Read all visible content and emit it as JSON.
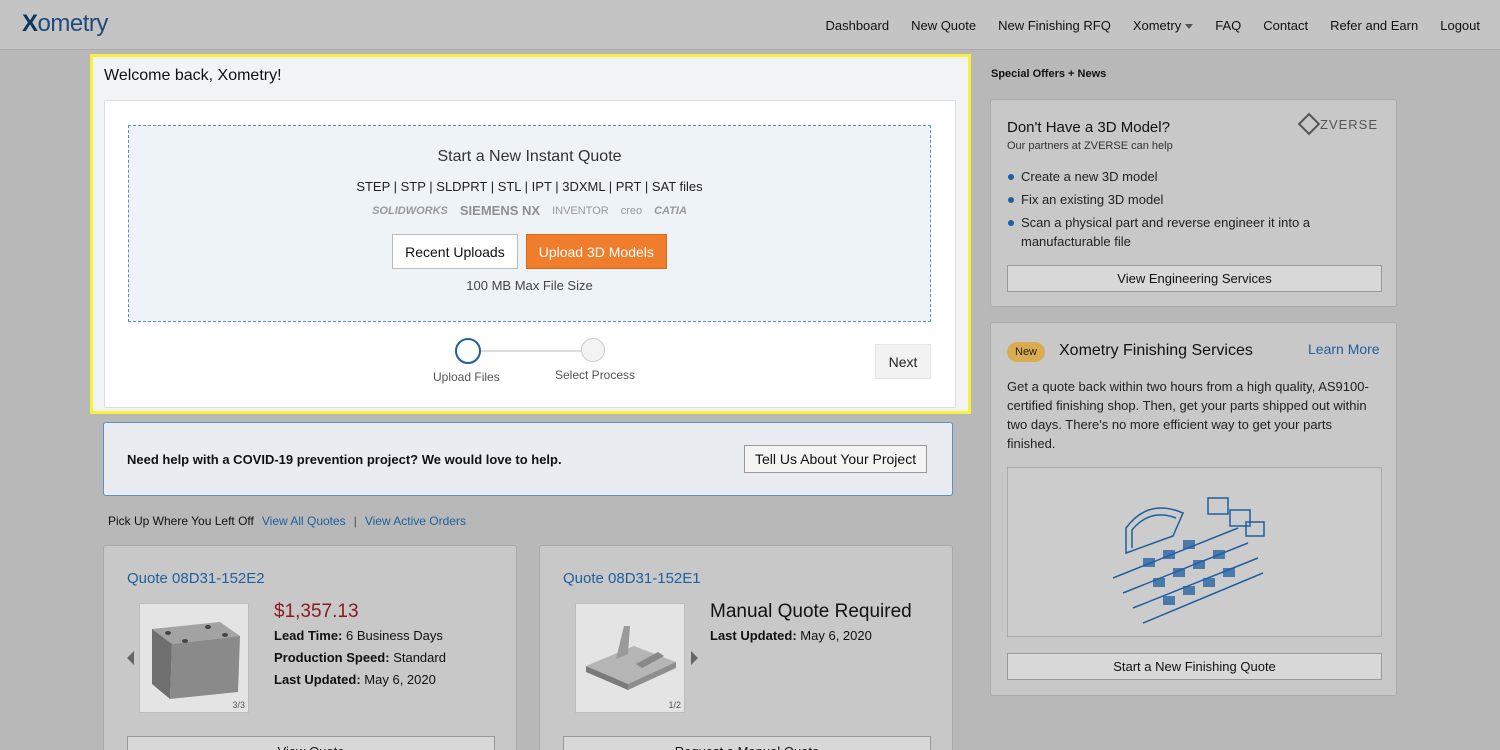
{
  "nav": {
    "logo": "Xometry",
    "items": [
      "Dashboard",
      "New Quote",
      "New Finishing RFQ",
      "Xometry",
      "FAQ",
      "Contact",
      "Refer and Earn",
      "Logout"
    ]
  },
  "welcome": {
    "title": "Welcome back, Xometry!",
    "dropzone_title": "Start a New Instant Quote",
    "formats": "STEP | STP | SLDPRT | STL | IPT | 3DXML | PRT | SAT files",
    "cad_logos": [
      "SOLIDWORKS",
      "SIEMENS NX",
      "INVENTOR",
      "creo",
      "CATIA"
    ],
    "recent_uploads": "Recent Uploads",
    "upload_button": "Upload 3D Models",
    "max_size": "100 MB Max File Size",
    "step1": "Upload Files",
    "step2": "Select Process",
    "next": "Next"
  },
  "covid": {
    "text": "Need help with a COVID-19 prevention project? We would love to help.",
    "button": "Tell Us About Your Project"
  },
  "pickup": {
    "label": "Pick Up Where You Left Off",
    "view_quotes": "View All Quotes",
    "separator": "|",
    "view_orders": "View Active Orders"
  },
  "quotes": [
    {
      "title": "Quote 08D31-152E2",
      "price": "$1,357.13",
      "lead_label": "Lead Time:",
      "lead": "6 Business Days",
      "speed_label": "Production Speed:",
      "speed": "Standard",
      "updated_label": "Last Updated:",
      "updated": "May 6, 2020",
      "page": "3/3",
      "button": "View Quote"
    },
    {
      "title": "Quote 08D31-152E1",
      "status": "Manual Quote Required",
      "updated_label": "Last Updated:",
      "updated": "May 6, 2020",
      "page": "1/2",
      "button": "Request a Manual Quote"
    }
  ],
  "sidebar": {
    "offers_title": "Special Offers + News",
    "zverse": {
      "heading": "Don't Have a 3D Model?",
      "sub": "Our partners at ZVERSE can help",
      "logo": "ZVERSE",
      "items": [
        "Create a new 3D model",
        "Fix an existing 3D model",
        "Scan a physical part and reverse engineer it into a manufacturable file"
      ],
      "button": "View Engineering Services"
    },
    "finishing": {
      "badge": "New",
      "title": "Xometry Finishing Services",
      "learn_more": "Learn More",
      "description": "Get a quote back within two hours from a high quality, AS9100-certified finishing shop. Then, get your parts shipped out within two days. There's no more efficient way to get your parts finished.",
      "button": "Start a New Finishing Quote"
    }
  },
  "colors": {
    "highlight": "#f7f13a",
    "accent_orange": "#f07d2b",
    "link_blue": "#1f5fa0",
    "price_red": "#8b1a1a"
  }
}
